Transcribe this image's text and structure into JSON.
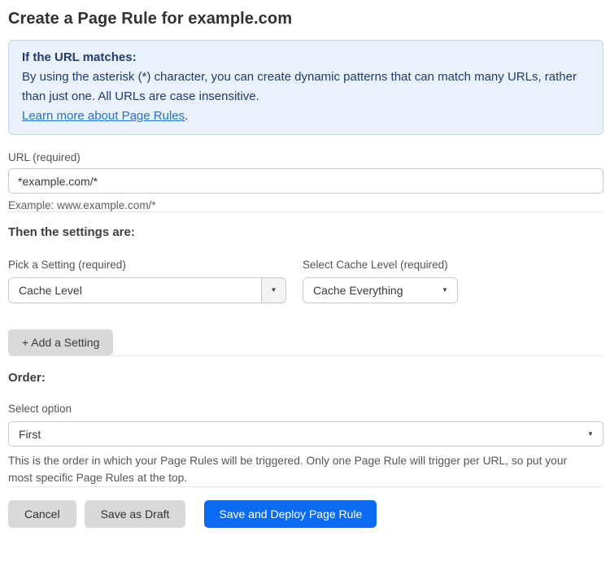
{
  "page": {
    "title": "Create a Page Rule for example.com"
  },
  "info_box": {
    "heading": "If the URL matches:",
    "body": "By using the asterisk (*) character, you can create dynamic patterns that can match many URLs, rather than just one. All URLs are case insensitive.",
    "link_text": "Learn more about Page Rules",
    "link_suffix": "."
  },
  "url_field": {
    "label": "URL (required)",
    "value": "*example.com/*",
    "helper": "Example: www.example.com/*"
  },
  "settings_section": {
    "heading": "Then the settings are:",
    "pick_setting": {
      "label": "Pick a Setting (required)",
      "selected": "Cache Level"
    },
    "cache_level": {
      "label": "Select Cache Level (required)",
      "selected": "Cache Everything"
    },
    "add_setting_button": "+ Add a Setting"
  },
  "order_section": {
    "heading": "Order:",
    "label": "Select option",
    "selected": "First",
    "helper": "This is the order in which your Page Rules will be triggered. Only one Page Rule will trigger per URL, so put your most specific Page Rules at the top."
  },
  "actions": {
    "cancel": "Cancel",
    "save_draft": "Save as Draft",
    "save_deploy": "Save and Deploy Page Rule"
  },
  "icons": {
    "dropdown_arrow": "▼"
  },
  "colors": {
    "info_bg": "#e9f1fb",
    "info_border": "#c2daf3",
    "info_text": "#223a6d",
    "link_blue": "#2c6ecb",
    "primary_button_bg": "#0b6cf3",
    "secondary_button_bg": "#d9d9d9"
  }
}
